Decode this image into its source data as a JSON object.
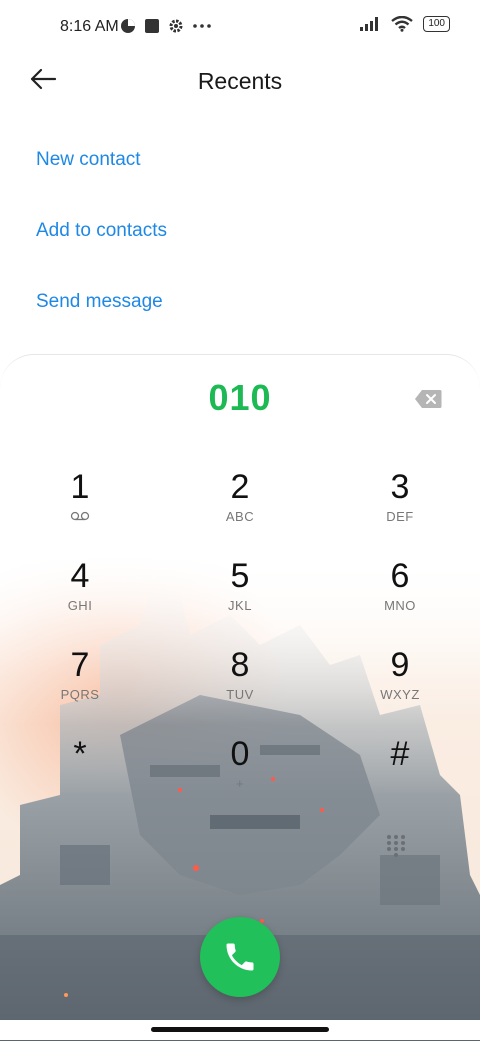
{
  "status_bar": {
    "time": "8:16 AM",
    "battery": "100",
    "icons": [
      "data-saver-icon",
      "square-icon",
      "gear-icon",
      "more-dots-icon",
      "signal-icon",
      "wifi-icon",
      "battery-icon"
    ]
  },
  "header": {
    "title": "Recents",
    "back_icon": "arrow-left-icon"
  },
  "actions": {
    "new_contact": "New contact",
    "add_to_contacts": "Add to contacts",
    "send_message": "Send message"
  },
  "dialer": {
    "number": "010",
    "keys": [
      {
        "digit": "1",
        "sub": ""
      },
      {
        "digit": "2",
        "sub": "ABC"
      },
      {
        "digit": "3",
        "sub": "DEF"
      },
      {
        "digit": "4",
        "sub": "GHI"
      },
      {
        "digit": "5",
        "sub": "JKL"
      },
      {
        "digit": "6",
        "sub": "MNO"
      },
      {
        "digit": "7",
        "sub": "PQRS"
      },
      {
        "digit": "8",
        "sub": "TUV"
      },
      {
        "digit": "9",
        "sub": "WXYZ"
      },
      {
        "digit": "*",
        "sub": ""
      },
      {
        "digit": "0",
        "sub": "+"
      },
      {
        "digit": "#",
        "sub": ""
      }
    ]
  },
  "colors": {
    "accent_link": "#1e88e5",
    "number_green": "#1db954",
    "call_button": "#21c05a"
  }
}
